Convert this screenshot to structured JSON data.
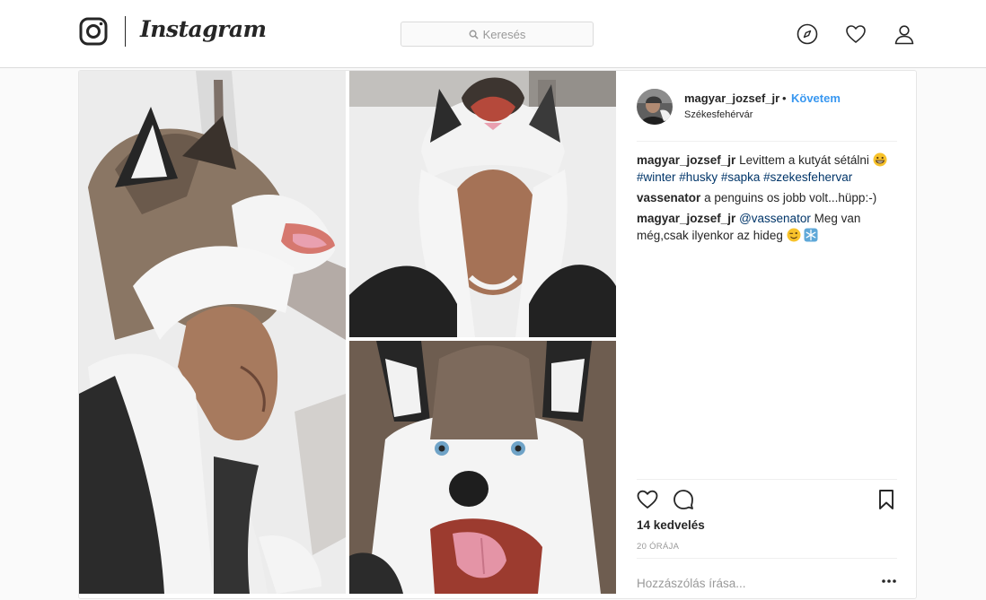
{
  "nav": {
    "brand": "Instagram",
    "search": {
      "placeholder": "Keresés"
    },
    "icons": [
      "instagram-logo-icon",
      "compass-icon",
      "heart-icon",
      "profile-icon"
    ]
  },
  "post": {
    "author": {
      "username": "magyar_jozsef_jr",
      "separator": "•",
      "follow_label": "Követem",
      "location": "Székesfehérvár"
    },
    "caption": {
      "username": "magyar_jozsef_jr",
      "text": "Levittem a kutyát sétálni",
      "emoji": "grinning-face-emoji",
      "hashtags": [
        "#winter",
        "#husky",
        "#sapka",
        "#szekesfehervar"
      ]
    },
    "comments": [
      {
        "username": "vassenator",
        "text": "a penguins os jobb volt...hüpp:-)"
      },
      {
        "username": "magyar_jozsef_jr",
        "mention": "@vassenator",
        "text": "Meg van még,csak ilyenkor az hideg",
        "emojis": [
          "winking-face-emoji",
          "snowflake-emoji"
        ]
      }
    ],
    "actions": [
      "like-heart-icon",
      "comment-bubble-icon",
      "save-bookmark-icon"
    ],
    "likes": "14 kedvelés",
    "timestamp": "20 ÓRÁJA",
    "comment_box": {
      "placeholder": "Hozzászólás írása..."
    },
    "more_label": "•••"
  },
  "colors": {
    "link_blue": "#3897f0",
    "hashtag_blue": "#003569",
    "text": "#262626",
    "muted": "#999999",
    "border": "#dbdbdb"
  }
}
